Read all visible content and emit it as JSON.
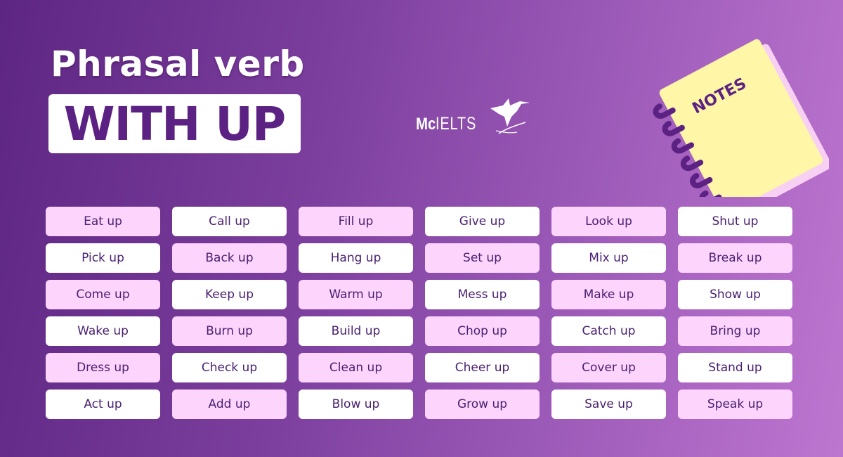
{
  "header": {
    "title_line1": "Phrasal verb",
    "title_line2": "WITH UP"
  },
  "logo": {
    "brand_bold": "Mc",
    "brand_light": "IELTS",
    "icon": "hummingbird-icon"
  },
  "illustration": {
    "label": "NOTES",
    "icon": "notebook-icon"
  },
  "colors": {
    "accent_purple": "#5b2283",
    "cell_pink": "#fcd4fc",
    "cell_white": "#ffffff",
    "notebook_yellow": "#fff6a8",
    "text_dark": "#4a2070"
  },
  "grid": {
    "rows": [
      [
        "Eat up",
        "Call up",
        "Fill up",
        "Give up",
        "Look up",
        "Shut up"
      ],
      [
        "Pick up",
        "Back up",
        "Hang up",
        "Set up",
        "Mix up",
        "Break up"
      ],
      [
        "Come up",
        "Keep up",
        "Warm up",
        "Mess up",
        "Make up",
        "Show up"
      ],
      [
        "Wake up",
        "Burn up",
        "Build up",
        "Chop up",
        "Catch up",
        "Bring up"
      ],
      [
        "Dress up",
        "Check up",
        "Clean up",
        "Cheer up",
        "Cover up",
        "Stand up"
      ],
      [
        "Act up",
        "Add up",
        "Blow up",
        "Grow up",
        "Save up",
        "Speak up"
      ]
    ]
  }
}
